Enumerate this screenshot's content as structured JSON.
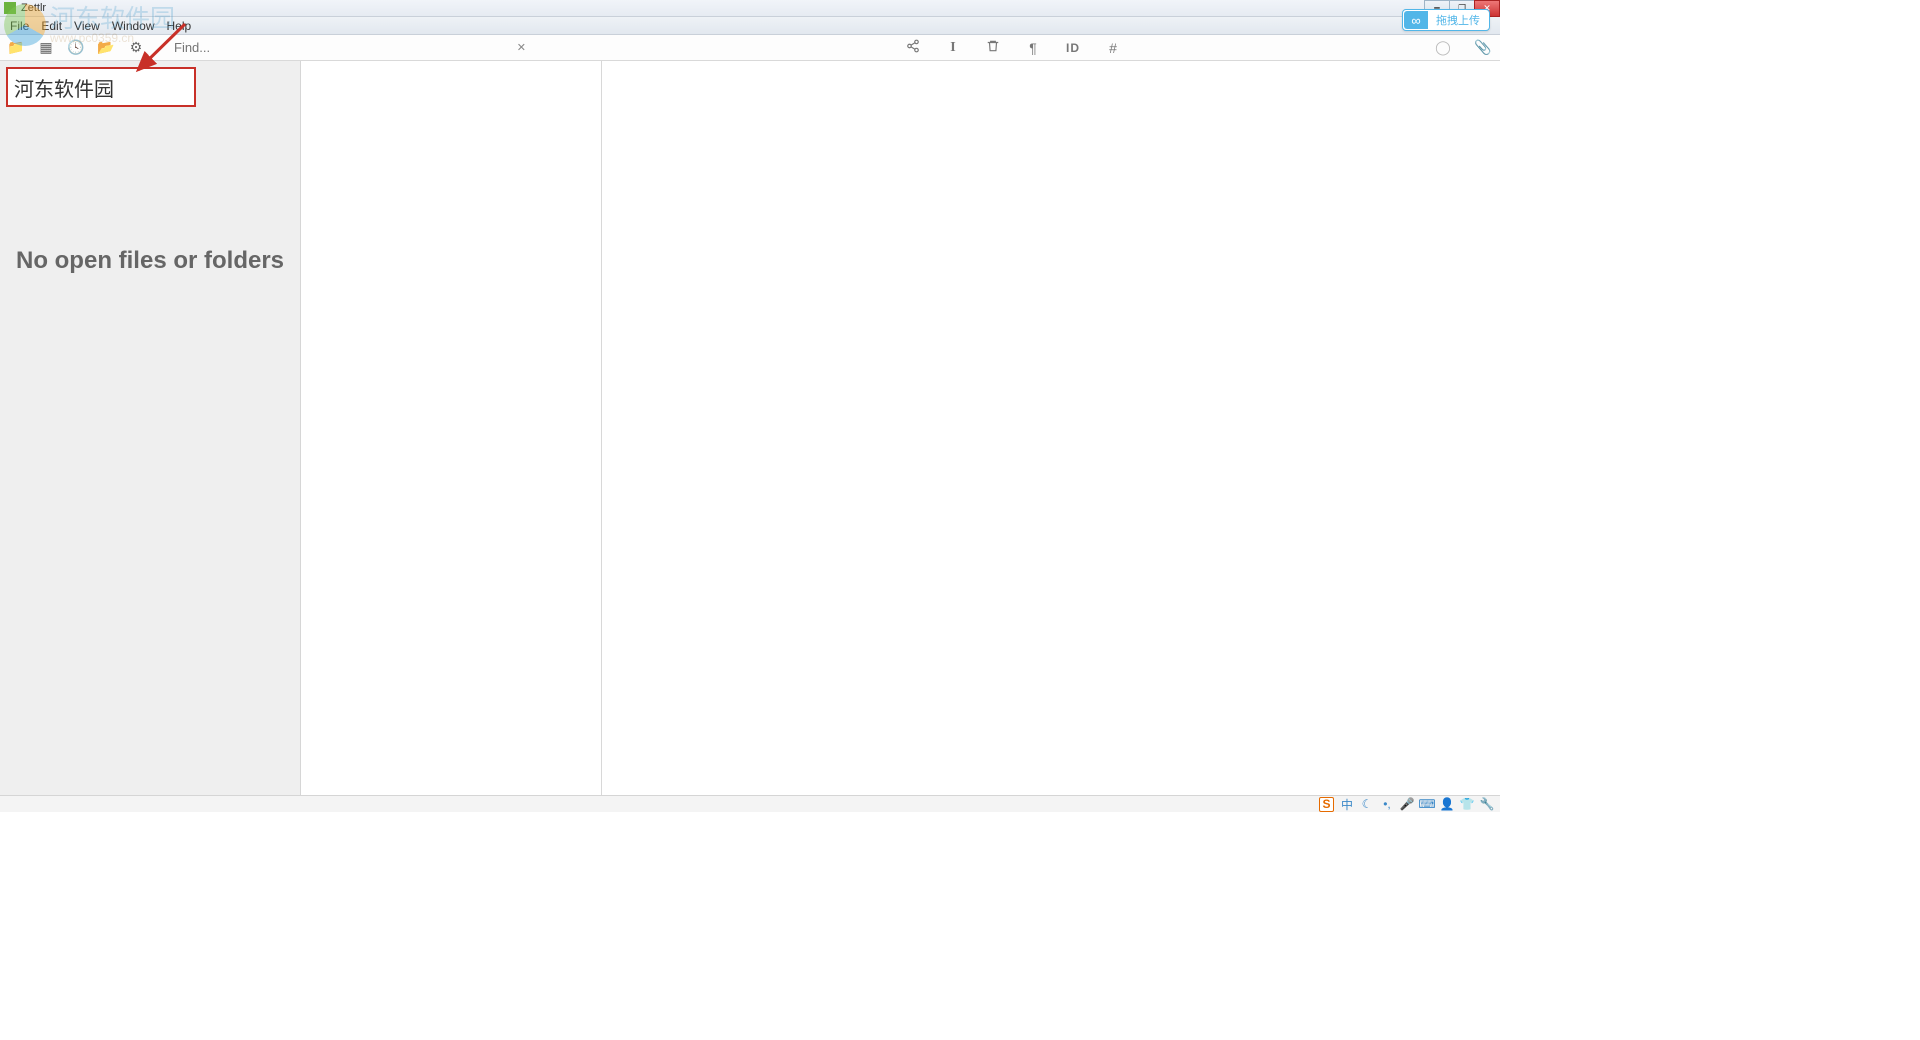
{
  "app": {
    "title": "Zettlr"
  },
  "menu": {
    "items": [
      "File",
      "Edit",
      "View",
      "Window",
      "Help"
    ]
  },
  "toolbar": {
    "find_placeholder": "Find...",
    "right_icons": [
      "share-icon",
      "info-icon",
      "trash-icon",
      "paragraph-icon",
      "id-icon",
      "hash-icon",
      "circle-icon",
      "paperclip-icon"
    ],
    "right_labels": {
      "id": "ID"
    }
  },
  "badge": {
    "label": "拖拽上传"
  },
  "sidebar": {
    "input_value": "河东软件园",
    "empty_message": "No open files or folders"
  },
  "watermark": {
    "text": "河东软件园",
    "url": "www.pc0359.cn"
  },
  "statusbar": {
    "ime_letter": "S",
    "lang": "中"
  }
}
